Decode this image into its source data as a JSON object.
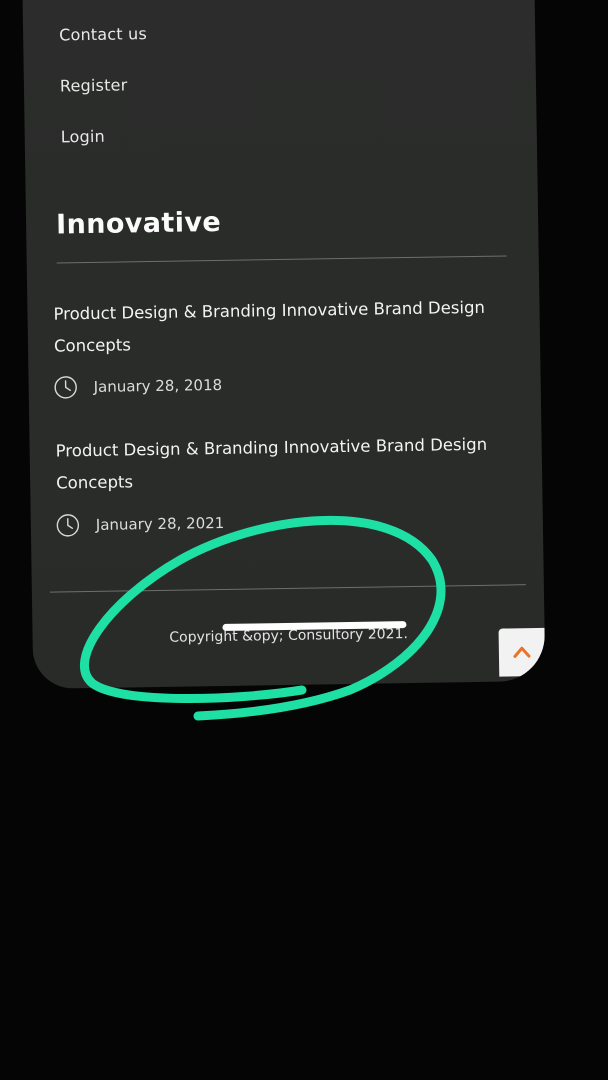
{
  "footer_nav": {
    "items": [
      "Contact us",
      "Register",
      "Login"
    ]
  },
  "innovative": {
    "title": "Innovative",
    "posts": [
      {
        "title": "Product Design & Branding Innovative Brand Design Concepts",
        "date": "January 28, 2018"
      },
      {
        "title": "Product Design & Branding Innovative Brand Design Concepts",
        "date": "January 28, 2021"
      }
    ]
  },
  "footer": {
    "copyright": "Copyright &opy; Consultory 2021."
  },
  "icons": {
    "post_date": "clock-icon",
    "scroll_top": "arrow-up-icon"
  },
  "colors": {
    "screen_background": "#2b2c2b",
    "annotation_stroke": "#1fe0a4",
    "scroll_arrow": "#e8742c"
  }
}
